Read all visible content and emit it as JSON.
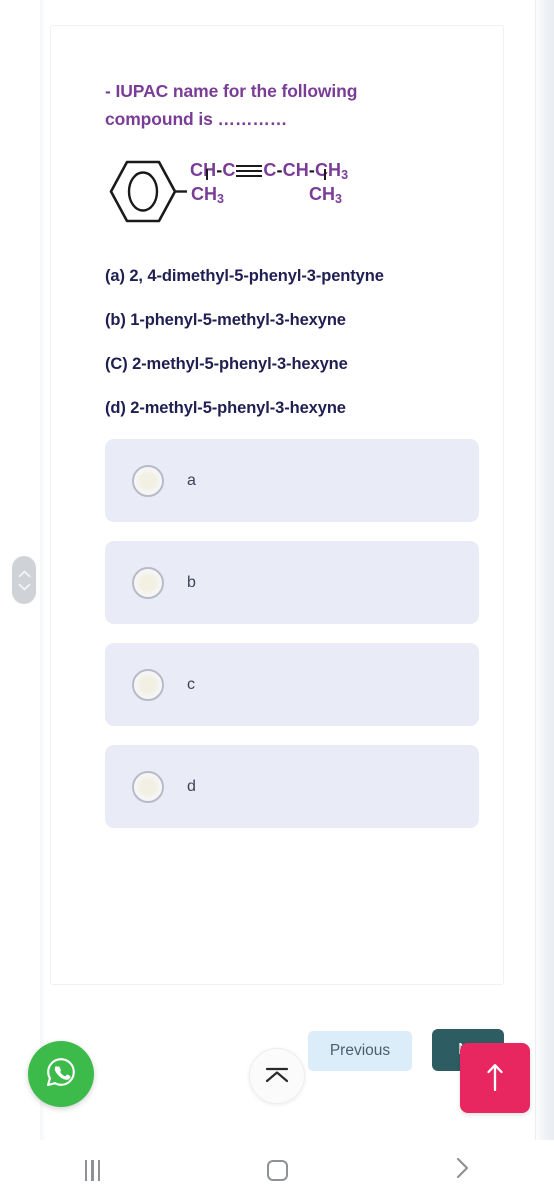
{
  "question": {
    "prompt": "- IUPAC name for the following compound is …………",
    "structure": {
      "ring_icon": "benzene-ring",
      "chain_top": [
        "CH",
        "-",
        "C",
        "≡",
        "C",
        "-",
        "CH",
        "-",
        "CH",
        "3"
      ],
      "chain_top_text": "CH-C≡C-CH-CH3",
      "substituent_left": "CH3",
      "substituent_right": "CH3"
    },
    "options_text": [
      "(a) 2, 4-dimethyl-5-phenyl-3-pentyne",
      "(b) 1-phenyl-5-methyl-3-hexyne",
      "(C) 2-methyl-5-phenyl-3-hexyne",
      "(d) 2-methyl-5-phenyl-3-hexyne"
    ]
  },
  "choices": [
    {
      "label": "a",
      "selected": false
    },
    {
      "label": "b",
      "selected": false
    },
    {
      "label": "c",
      "selected": false
    },
    {
      "label": "d",
      "selected": false
    }
  ],
  "actions": {
    "previous_label": "Previous",
    "next_label": "Next",
    "whatsapp_icon": "whatsapp-icon",
    "collapse_icon": "collapse-up-icon",
    "scrolltop_icon": "arrow-up-icon"
  },
  "navbar": {
    "recents_icon": "recents-icon",
    "home_icon": "home-icon",
    "back_icon": "back-chevron-icon"
  },
  "scroll_handle": {
    "up_icon": "chevron-up-icon",
    "down_icon": "chevron-down-icon"
  },
  "colors": {
    "question_purple": "#7a3d96",
    "option_navy": "#1f1f52",
    "choice_card": "#e9ebf7",
    "previous_bg": "#dcedfa",
    "next_bg": "#2d5d62",
    "scrolltop_bg": "#e8265f",
    "whatsapp_green": "#3cbb4b"
  }
}
